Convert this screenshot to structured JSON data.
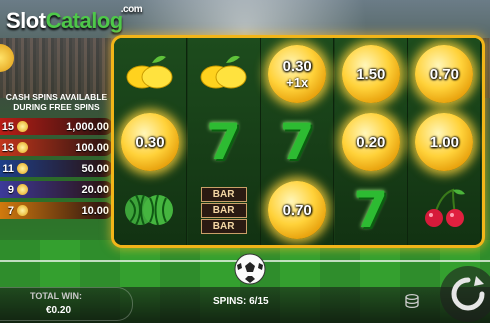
{
  "logo": {
    "part1": "Slot",
    "part2": "Catalog",
    "suffix": ".com"
  },
  "free_spins_note": [
    "CASH SPINS AVAILABLE",
    "DURING FREE SPINS"
  ],
  "paytable": [
    {
      "count": "15",
      "value": "1,000.00",
      "color": "#b81d16"
    },
    {
      "count": "13",
      "value": "100.00",
      "color": "#c2361c"
    },
    {
      "count": "11",
      "value": "50.00",
      "color": "#1d3f8a"
    },
    {
      "count": "9",
      "value": "20.00",
      "color": "#3d3a9a"
    },
    {
      "count": "7",
      "value": "10.00",
      "color": "#d07a0e"
    }
  ],
  "reels": [
    [
      {
        "type": "lemon"
      },
      {
        "type": "ball",
        "value": "0.30"
      },
      {
        "type": "melon"
      }
    ],
    [
      {
        "type": "lemon"
      },
      {
        "type": "seven"
      },
      {
        "type": "bar",
        "labels": [
          "BAR",
          "BAR",
          "BAR"
        ]
      }
    ],
    [
      {
        "type": "ball",
        "value": "0.30",
        "mult": "+1x"
      },
      {
        "type": "seven"
      },
      {
        "type": "ball",
        "value": "0.70"
      }
    ],
    [
      {
        "type": "ball",
        "value": "1.50"
      },
      {
        "type": "ball",
        "value": "0.20"
      },
      {
        "type": "seven"
      }
    ],
    [
      {
        "type": "ball",
        "value": "0.70"
      },
      {
        "type": "ball",
        "value": "1.00"
      },
      {
        "type": "cherry"
      }
    ]
  ],
  "bottom_bar": {
    "total_win_label": "TOTAL WIN:",
    "total_win_value": "€0.20",
    "spins_text": "SPINS: 6/15"
  },
  "colors": {
    "frame": "#f2b519",
    "reel_bg": "#163a16"
  }
}
